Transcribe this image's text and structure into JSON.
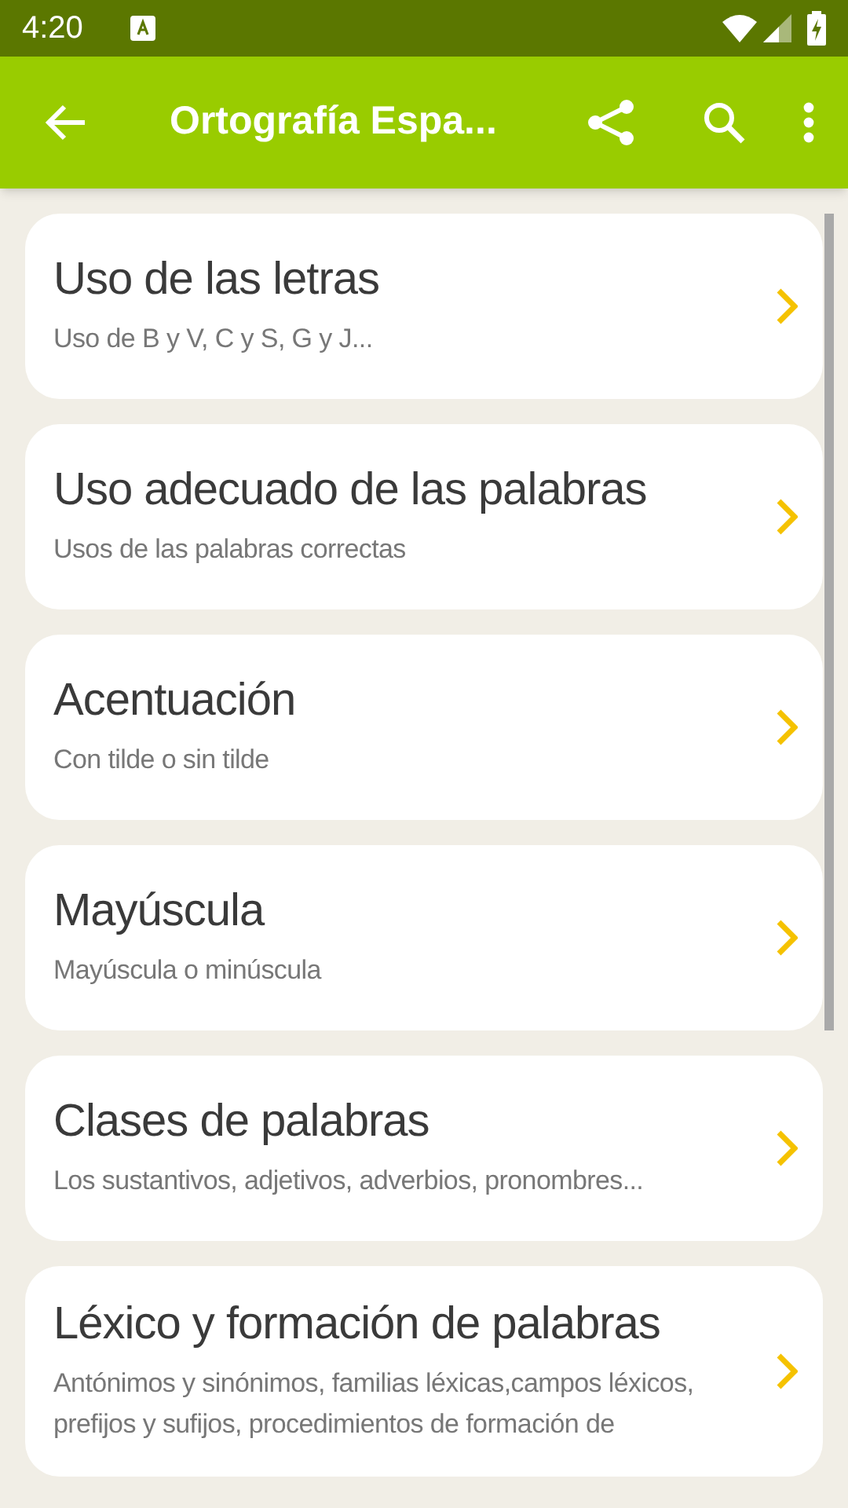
{
  "status_bar": {
    "time": "4:20"
  },
  "app_bar": {
    "title": "Ortografía Espa..."
  },
  "items": [
    {
      "title": "Uso de las letras",
      "subtitle": "Uso de B y V, C y S, G y J..."
    },
    {
      "title": "Uso adecuado de las palabras",
      "subtitle": "Usos de las palabras correctas"
    },
    {
      "title": "Acentuación",
      "subtitle": "Con tilde o sin tilde"
    },
    {
      "title": "Mayúscula",
      "subtitle": "Mayúscula o minúscula"
    },
    {
      "title": "Clases de palabras",
      "subtitle": "Los sustantivos, adjetivos, adverbios, pronombres..."
    },
    {
      "title": "Léxico y formación de palabras",
      "subtitle": "Antónimos y sinónimos, familias léxicas,campos léxicos, prefijos y sufijos, procedimientos de formación de"
    }
  ]
}
